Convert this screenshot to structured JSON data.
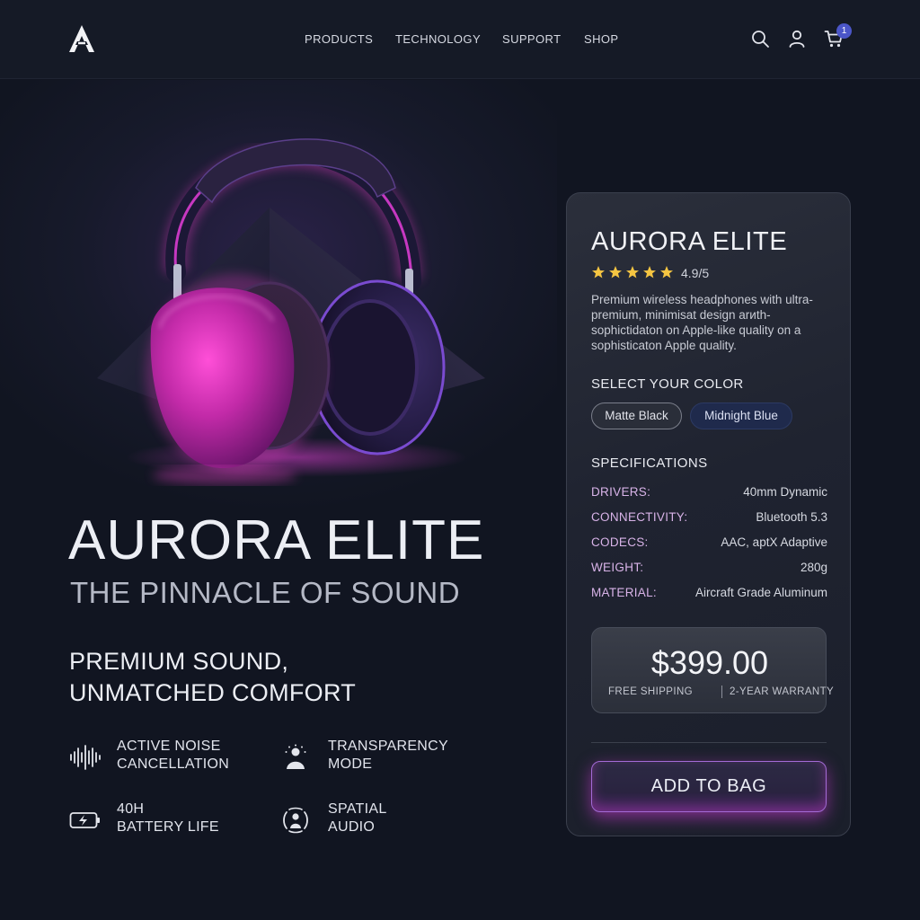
{
  "header": {
    "logo_icon": "aurora-a-logo",
    "nav": [
      "PRODUCTS",
      "TECHNOLOGY",
      "SUPPORT",
      "SHOP"
    ],
    "icons": [
      "search-icon",
      "user-icon",
      "cart-icon"
    ],
    "cart_count": "1"
  },
  "hero": {
    "image": "pink-purple-over-ear-headphones",
    "title": "AURORA ELITE",
    "subtitle": "THE PINNACLE OF SOUND",
    "tagline_line1": "PREMIUM SOUND,",
    "tagline_line2": "UNMATCHED COMFORT",
    "features": [
      {
        "icon": "sound-wave-icon",
        "line1": "ACTIVE NOISE",
        "line2": "CANCELLATION"
      },
      {
        "icon": "person-ambient-icon",
        "line1": "TRANSPARENCY",
        "line2": "MODE"
      },
      {
        "icon": "battery-charging-icon",
        "line1": "40H",
        "line2": "BATTERY LIFE"
      },
      {
        "icon": "spatial-audio-icon",
        "line1": "SPATIAL",
        "line2": "AUDIO"
      }
    ]
  },
  "product": {
    "title": "AURORA ELITE",
    "stars": 5,
    "rating": "4.9/5",
    "description": "Premium wireless headphones with ultra-premium, minimisat design arиth-sophictidaton on Apple-like quality on a sophisticaton Apple quality.",
    "color_heading": "SELECT YOUR COLOR",
    "colors": [
      "Matte Black",
      "Midnight Blue"
    ],
    "spec_heading": "SPECIFICATIONS",
    "specs": [
      {
        "key": "DRIVERS:",
        "value": "40mm Dynamic"
      },
      {
        "key": "CONNECTIVITY:",
        "value": "Bluetooth 5.3"
      },
      {
        "key": "CODECS:",
        "value": "AAC, aptX Adaptive"
      },
      {
        "key": "WEIGHT:",
        "value": "280g"
      },
      {
        "key": "MATERIAL:",
        "value": "Aircraft Grade Aluminum"
      }
    ],
    "price": "$399.00",
    "shipping": "FREE SHIPPING",
    "warranty": "2-YEAR WARRANTY",
    "cta": "ADD TO BAG"
  },
  "colors": {
    "background": "#111521",
    "accent_pink": "#e03bd8",
    "accent_blue": "#4b56c8",
    "star": "#f5c542"
  }
}
